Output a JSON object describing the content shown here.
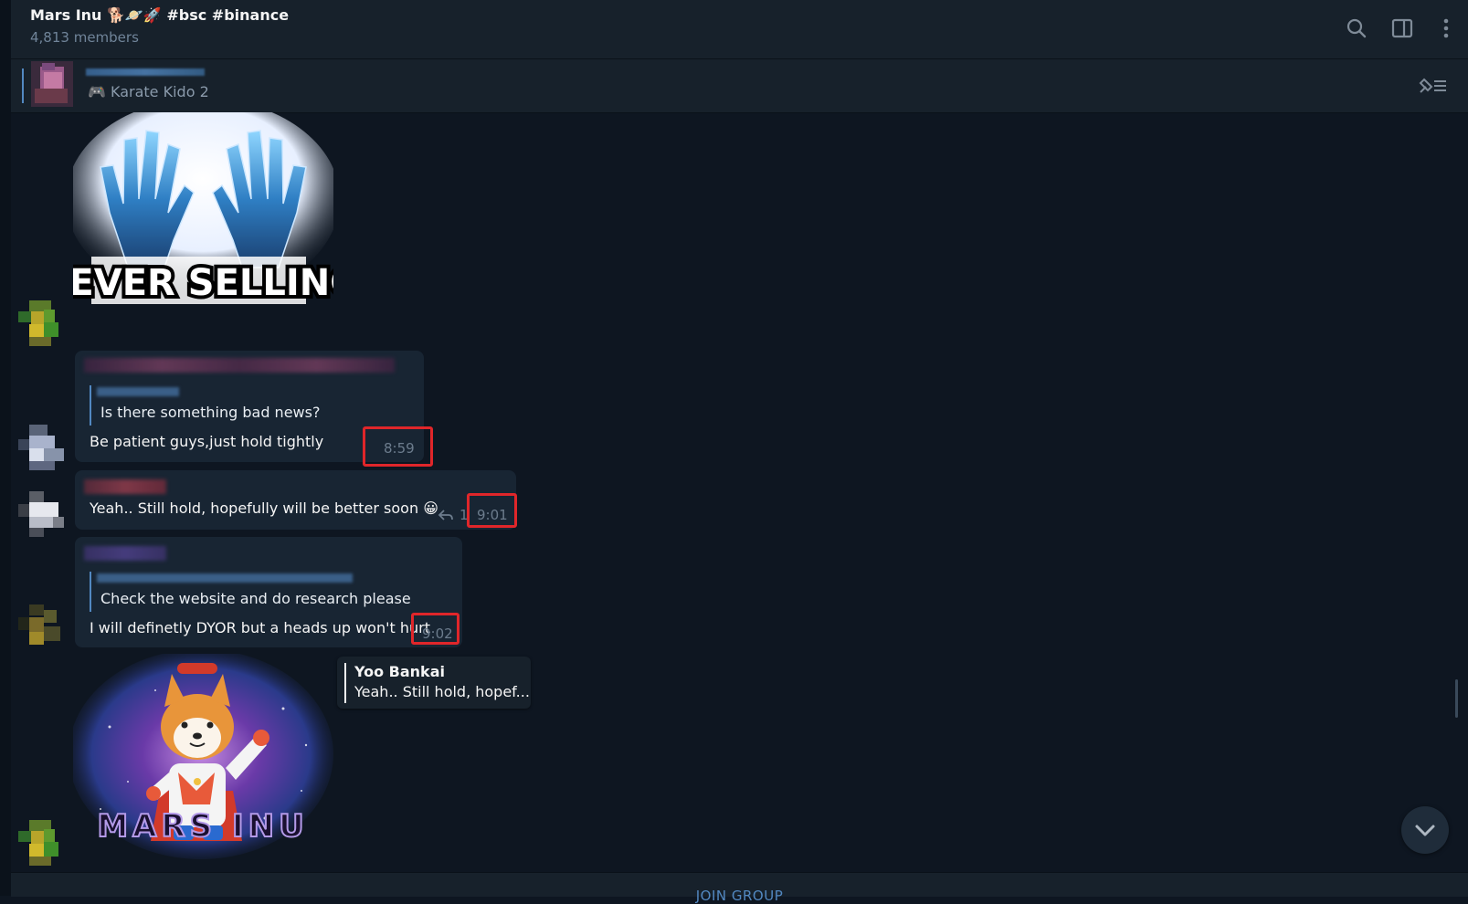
{
  "header": {
    "title": "Mars Inu 🐕🪐🚀 #bsc #binance",
    "subtitle": "4,813 members",
    "icons": [
      "search-icon",
      "sidebar-toggle-icon",
      "more-vertical-icon"
    ]
  },
  "pinned": {
    "text": "🎮 Karate Kido 2",
    "icon": "pinned-list-icon"
  },
  "messages": [
    {
      "kind": "sticker",
      "sticker_text": "NEVER SELLING"
    },
    {
      "kind": "text",
      "reply_text": "Is there something bad news?",
      "text": "Be patient guys,just hold tightly",
      "time": "8:59"
    },
    {
      "kind": "text",
      "text": "Yeah.. Still hold, hopefully will be better soon 😀",
      "reply_count": "1",
      "time": "9:01"
    },
    {
      "kind": "text",
      "reply_text": "Check the website and do research please",
      "text": "I will definetly DYOR but a heads up won't hurt",
      "time": "9:02"
    },
    {
      "kind": "sticker",
      "sticker_text": "MARS INU"
    }
  ],
  "reply_preview": {
    "name": "Yoo Bankai",
    "text": "Yeah.. Still hold, hopef..."
  },
  "bottom": {
    "join_label": "JOIN GROUP"
  },
  "colors": {
    "background": "#0e1621",
    "panel": "#17212b",
    "bubble": "#182533",
    "accent": "#5288c1",
    "highlight_box": "#e0262a"
  }
}
